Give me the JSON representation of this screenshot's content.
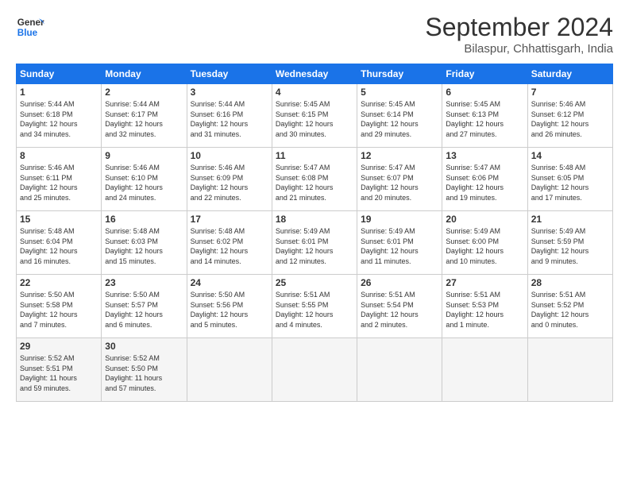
{
  "header": {
    "logo_line1": "General",
    "logo_line2": "Blue",
    "month": "September 2024",
    "location": "Bilaspur, Chhattisgarh, India"
  },
  "weekdays": [
    "Sunday",
    "Monday",
    "Tuesday",
    "Wednesday",
    "Thursday",
    "Friday",
    "Saturday"
  ],
  "weeks": [
    [
      {
        "day": "1",
        "detail": "Sunrise: 5:44 AM\nSunset: 6:18 PM\nDaylight: 12 hours\nand 34 minutes."
      },
      {
        "day": "2",
        "detail": "Sunrise: 5:44 AM\nSunset: 6:17 PM\nDaylight: 12 hours\nand 32 minutes."
      },
      {
        "day": "3",
        "detail": "Sunrise: 5:44 AM\nSunset: 6:16 PM\nDaylight: 12 hours\nand 31 minutes."
      },
      {
        "day": "4",
        "detail": "Sunrise: 5:45 AM\nSunset: 6:15 PM\nDaylight: 12 hours\nand 30 minutes."
      },
      {
        "day": "5",
        "detail": "Sunrise: 5:45 AM\nSunset: 6:14 PM\nDaylight: 12 hours\nand 29 minutes."
      },
      {
        "day": "6",
        "detail": "Sunrise: 5:45 AM\nSunset: 6:13 PM\nDaylight: 12 hours\nand 27 minutes."
      },
      {
        "day": "7",
        "detail": "Sunrise: 5:46 AM\nSunset: 6:12 PM\nDaylight: 12 hours\nand 26 minutes."
      }
    ],
    [
      {
        "day": "8",
        "detail": "Sunrise: 5:46 AM\nSunset: 6:11 PM\nDaylight: 12 hours\nand 25 minutes."
      },
      {
        "day": "9",
        "detail": "Sunrise: 5:46 AM\nSunset: 6:10 PM\nDaylight: 12 hours\nand 24 minutes."
      },
      {
        "day": "10",
        "detail": "Sunrise: 5:46 AM\nSunset: 6:09 PM\nDaylight: 12 hours\nand 22 minutes."
      },
      {
        "day": "11",
        "detail": "Sunrise: 5:47 AM\nSunset: 6:08 PM\nDaylight: 12 hours\nand 21 minutes."
      },
      {
        "day": "12",
        "detail": "Sunrise: 5:47 AM\nSunset: 6:07 PM\nDaylight: 12 hours\nand 20 minutes."
      },
      {
        "day": "13",
        "detail": "Sunrise: 5:47 AM\nSunset: 6:06 PM\nDaylight: 12 hours\nand 19 minutes."
      },
      {
        "day": "14",
        "detail": "Sunrise: 5:48 AM\nSunset: 6:05 PM\nDaylight: 12 hours\nand 17 minutes."
      }
    ],
    [
      {
        "day": "15",
        "detail": "Sunrise: 5:48 AM\nSunset: 6:04 PM\nDaylight: 12 hours\nand 16 minutes."
      },
      {
        "day": "16",
        "detail": "Sunrise: 5:48 AM\nSunset: 6:03 PM\nDaylight: 12 hours\nand 15 minutes."
      },
      {
        "day": "17",
        "detail": "Sunrise: 5:48 AM\nSunset: 6:02 PM\nDaylight: 12 hours\nand 14 minutes."
      },
      {
        "day": "18",
        "detail": "Sunrise: 5:49 AM\nSunset: 6:01 PM\nDaylight: 12 hours\nand 12 minutes."
      },
      {
        "day": "19",
        "detail": "Sunrise: 5:49 AM\nSunset: 6:01 PM\nDaylight: 12 hours\nand 11 minutes."
      },
      {
        "day": "20",
        "detail": "Sunrise: 5:49 AM\nSunset: 6:00 PM\nDaylight: 12 hours\nand 10 minutes."
      },
      {
        "day": "21",
        "detail": "Sunrise: 5:49 AM\nSunset: 5:59 PM\nDaylight: 12 hours\nand 9 minutes."
      }
    ],
    [
      {
        "day": "22",
        "detail": "Sunrise: 5:50 AM\nSunset: 5:58 PM\nDaylight: 12 hours\nand 7 minutes."
      },
      {
        "day": "23",
        "detail": "Sunrise: 5:50 AM\nSunset: 5:57 PM\nDaylight: 12 hours\nand 6 minutes."
      },
      {
        "day": "24",
        "detail": "Sunrise: 5:50 AM\nSunset: 5:56 PM\nDaylight: 12 hours\nand 5 minutes."
      },
      {
        "day": "25",
        "detail": "Sunrise: 5:51 AM\nSunset: 5:55 PM\nDaylight: 12 hours\nand 4 minutes."
      },
      {
        "day": "26",
        "detail": "Sunrise: 5:51 AM\nSunset: 5:54 PM\nDaylight: 12 hours\nand 2 minutes."
      },
      {
        "day": "27",
        "detail": "Sunrise: 5:51 AM\nSunset: 5:53 PM\nDaylight: 12 hours\nand 1 minute."
      },
      {
        "day": "28",
        "detail": "Sunrise: 5:51 AM\nSunset: 5:52 PM\nDaylight: 12 hours\nand 0 minutes."
      }
    ],
    [
      {
        "day": "29",
        "detail": "Sunrise: 5:52 AM\nSunset: 5:51 PM\nDaylight: 11 hours\nand 59 minutes."
      },
      {
        "day": "30",
        "detail": "Sunrise: 5:52 AM\nSunset: 5:50 PM\nDaylight: 11 hours\nand 57 minutes."
      },
      {
        "day": "",
        "detail": ""
      },
      {
        "day": "",
        "detail": ""
      },
      {
        "day": "",
        "detail": ""
      },
      {
        "day": "",
        "detail": ""
      },
      {
        "day": "",
        "detail": ""
      }
    ]
  ]
}
